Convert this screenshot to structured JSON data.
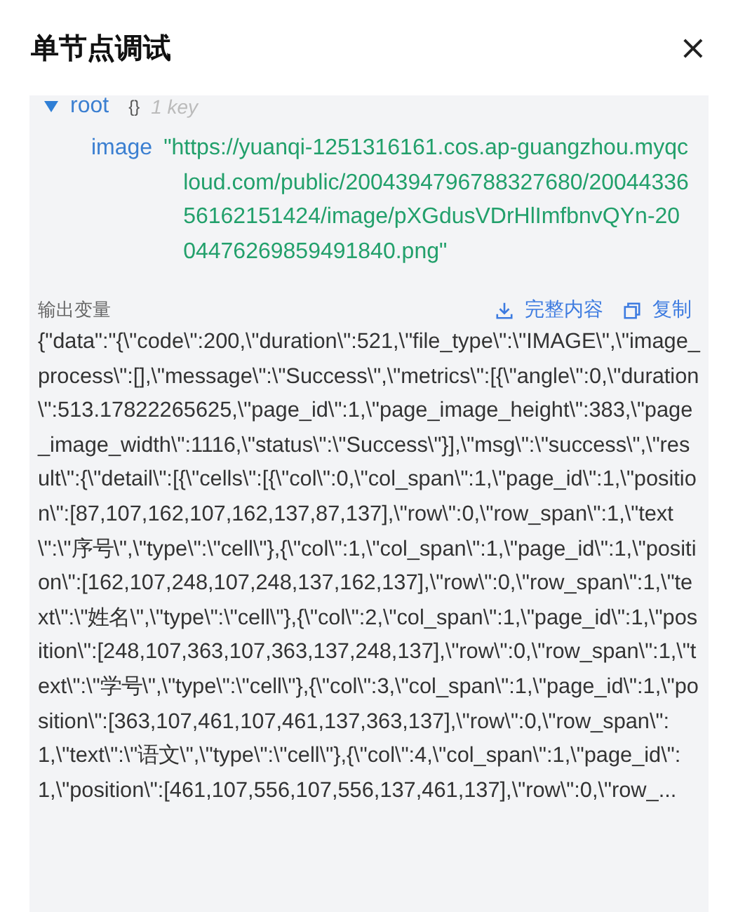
{
  "dialog": {
    "title": "单节点调试",
    "close": "×"
  },
  "tree": {
    "root": {
      "key": "root",
      "expanded": true,
      "type_icon": "{}",
      "summary": "1 key",
      "children": [
        {
          "key": "image",
          "value": "\"https://yuanqi-1251316161.cos.ap-guangzhou.myqcloud.com/public/2004394796788327680/2004433656162151424/image/pXGdusVDrHlImfbnvQYn-2004476269859491840.png\""
        }
      ]
    }
  },
  "output": {
    "label": "输出变量",
    "actions": [
      {
        "kind": "download",
        "label": "完整内容"
      },
      {
        "kind": "copy",
        "label": "复制"
      }
    ],
    "text": "{\"data\":\"{\\\"code\\\":200,\\\"duration\\\":521,\\\"file_type\\\":\\\"IMAGE\\\",\\\"image_process\\\":[],\\\"message\\\":\\\"Success\\\",\\\"metrics\\\":[{\\\"angle\\\":0,\\\"duration\\\":513.17822265625,\\\"page_id\\\":1,\\\"page_image_height\\\":383,\\\"page_image_width\\\":1116,\\\"status\\\":\\\"Success\\\"}],\\\"msg\\\":\\\"success\\\",\\\"result\\\":{\\\"detail\\\":[{\\\"cells\\\":[{\\\"col\\\":0,\\\"col_span\\\":1,\\\"page_id\\\":1,\\\"position\\\":[87,107,162,107,162,137,87,137],\\\"row\\\":0,\\\"row_span\\\":1,\\\"text\\\":\\\"序号\\\",\\\"type\\\":\\\"cell\\\"},{\\\"col\\\":1,\\\"col_span\\\":1,\\\"page_id\\\":1,\\\"position\\\":[162,107,248,107,248,137,162,137],\\\"row\\\":0,\\\"row_span\\\":1,\\\"text\\\":\\\"姓名\\\",\\\"type\\\":\\\"cell\\\"},{\\\"col\\\":2,\\\"col_span\\\":1,\\\"page_id\\\":1,\\\"position\\\":[248,107,363,107,363,137,248,137],\\\"row\\\":0,\\\"row_span\\\":1,\\\"text\\\":\\\"学号\\\",\\\"type\\\":\\\"cell\\\"},{\\\"col\\\":3,\\\"col_span\\\":1,\\\"page_id\\\":1,\\\"position\\\":[363,107,461,107,461,137,363,137],\\\"row\\\":0,\\\"row_span\\\":1,\\\"text\\\":\\\"语文\\\",\\\"type\\\":\\\"cell\\\"},{\\\"col\\\":4,\\\"col_span\\\":1,\\\"page_id\\\":1,\\\"position\\\":[461,107,556,107,556,137,461,137],\\\"row\\\":0,\\\"row_..."
  }
}
